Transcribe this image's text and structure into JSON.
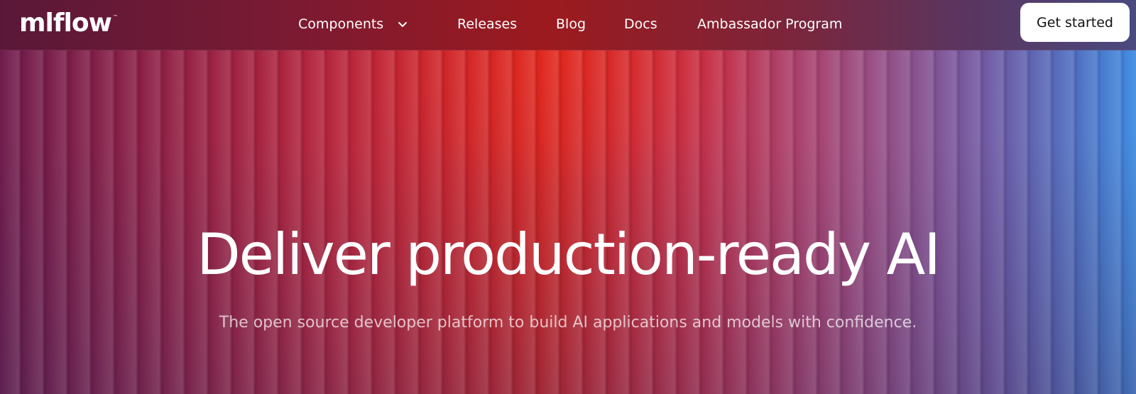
{
  "brand": {
    "logo_text": "mlflow",
    "logo_tm": "™"
  },
  "nav": {
    "items": [
      {
        "label": "Components",
        "has_dropdown": true
      },
      {
        "label": "Releases"
      },
      {
        "label": "Blog"
      },
      {
        "label": "Docs"
      },
      {
        "label": "Ambassador Program"
      }
    ],
    "cta_label": "Get started"
  },
  "hero": {
    "title": "Deliver production-ready AI",
    "subtitle": "The open source developer platform to build AI applications and models with confidence."
  },
  "icons": {
    "dropdown": "chevron-down-icon"
  },
  "colors": {
    "accent_red": "#d42420",
    "accent_blue": "#3c8ae0",
    "text": "#ffffff",
    "cta_background": "#ffffff",
    "cta_text": "#111111"
  }
}
